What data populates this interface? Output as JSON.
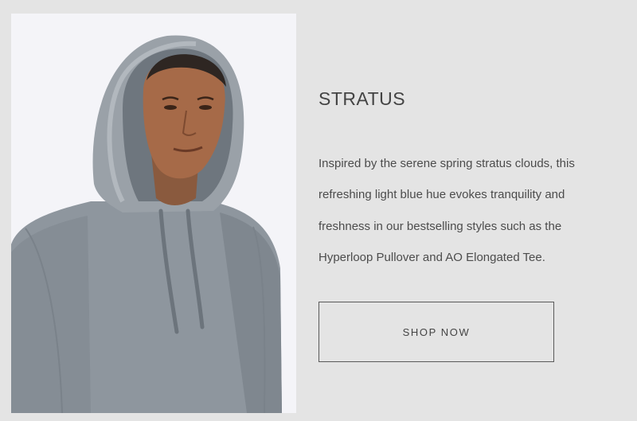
{
  "product": {
    "image_alt": "Man wearing a light blue-gray hoodie with the hood up",
    "title": "STRATUS",
    "description_lines": [
      "Inspired by the serene spring stratus clouds, this",
      "refreshing light blue hue evokes tranquility and",
      "freshness in our bestselling styles such as the",
      "Hyperloop Pullover and AO Elongated Tee."
    ],
    "cta_label": "SHOP NOW"
  },
  "colors": {
    "background": "#e4e4e4",
    "photo_background": "#f4f4f8",
    "hoodie": "#8e969e",
    "text": "#444444",
    "button_border": "#5a5a5a"
  }
}
